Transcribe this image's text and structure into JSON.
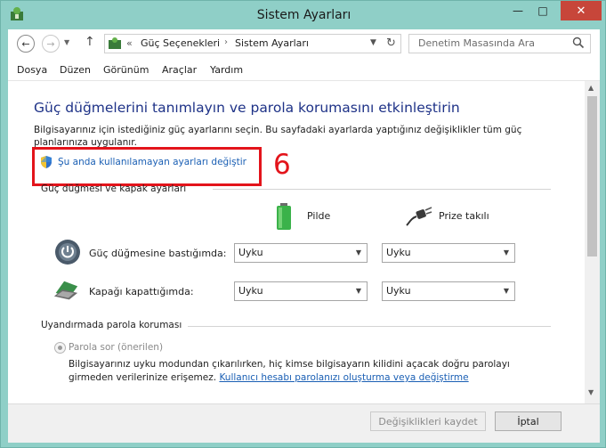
{
  "window": {
    "title": "Sistem Ayarları"
  },
  "address": {
    "breadcrumbs": [
      "Güç Seçenekleri",
      "Sistem Ayarları"
    ],
    "search_placeholder": "Denetim Masasında Ara"
  },
  "menu": [
    "Dosya",
    "Düzen",
    "Görünüm",
    "Araçlar",
    "Yardım"
  ],
  "page": {
    "heading": "Güç düğmelerini tanımlayın ve parola korumasını etkinleştirin",
    "intro": "Bilgisayarınız için istediğiniz güç ayarlarını seçin. Bu sayfadaki ayarlarda yaptığınız değişiklikler tüm güç planlarınıza uygulanır.",
    "change_link": "Şu anda kullanılamayan ayarları değiştir",
    "annotation_number": "6",
    "section_power": "Güç düğmesi ve kapak ayarları",
    "col_battery": "Pilde",
    "col_plugged": "Prize takılı",
    "rows": [
      {
        "label": "Güç düğmesine bastığımda:",
        "battery": "Uyku",
        "plugged": "Uyku"
      },
      {
        "label": "Kapağı kapattığımda:",
        "battery": "Uyku",
        "plugged": "Uyku"
      }
    ],
    "section_password": "Uyandırmada parola koruması",
    "radio_label": "Parola sor (önerilen)",
    "desc_text": "Bilgisayarınız uyku modundan çıkarılırken, hiç kimse bilgisayarın kilidini açacak doğru parolayı girmeden verilerinize erişemez.",
    "desc_link": "Kullanıcı hesabı parolanızı oluşturma veya değiştirme"
  },
  "footer": {
    "save": "Değişiklikleri kaydet",
    "cancel": "İptal"
  },
  "colors": {
    "link": "#1a5fb4",
    "heading": "#1e3287",
    "annotation": "#e3141b",
    "frame": "#8fcfc7"
  }
}
